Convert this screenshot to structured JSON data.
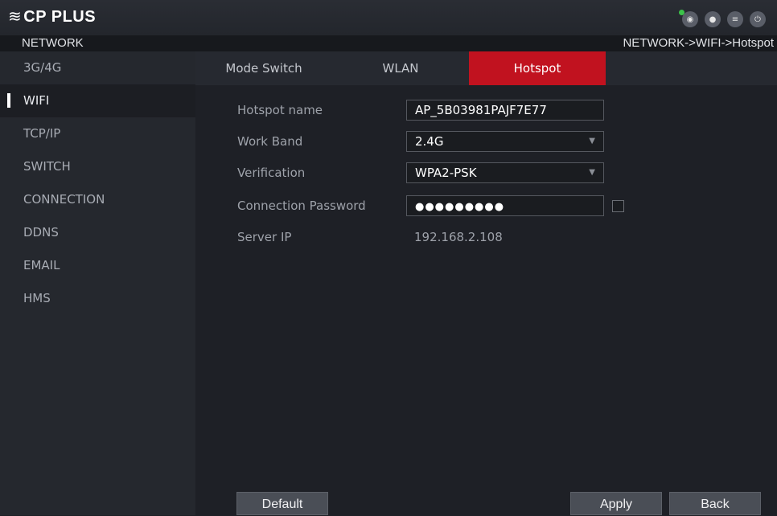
{
  "header": {
    "logo": "CP PLUS",
    "logo_mark": "≋",
    "icons": [
      "eye-icon",
      "user-icon",
      "menu-icon",
      "power-icon"
    ]
  },
  "subbar": {
    "section": "NETWORK",
    "breadcrumb": "NETWORK->WIFI->Hotspot"
  },
  "sidebar": {
    "items": [
      {
        "label": "3G/4G"
      },
      {
        "label": "WIFI"
      },
      {
        "label": "TCP/IP"
      },
      {
        "label": "SWITCH"
      },
      {
        "label": "CONNECTION"
      },
      {
        "label": "DDNS"
      },
      {
        "label": "EMAIL"
      },
      {
        "label": "HMS"
      }
    ],
    "active": "WIFI"
  },
  "tabs": [
    {
      "label": "Mode Switch"
    },
    {
      "label": "WLAN"
    },
    {
      "label": "Hotspot"
    }
  ],
  "form": {
    "hotspot_name_label": "Hotspot name",
    "hotspot_name_value": "AP_5B03981PAJF7E77",
    "work_band_label": "Work Band",
    "work_band_value": "2.4G",
    "verification_label": "Verification",
    "verification_value": "WPA2-PSK",
    "password_label": "Connection Password",
    "password_value": "●●●●●●●●●",
    "server_ip_label": "Server IP",
    "server_ip_value": "192.168.2.108"
  },
  "buttons": {
    "default": "Default",
    "apply": "Apply",
    "back": "Back"
  },
  "colors": {
    "accent": "#c1121f",
    "status_dot": "#3cc34a"
  }
}
